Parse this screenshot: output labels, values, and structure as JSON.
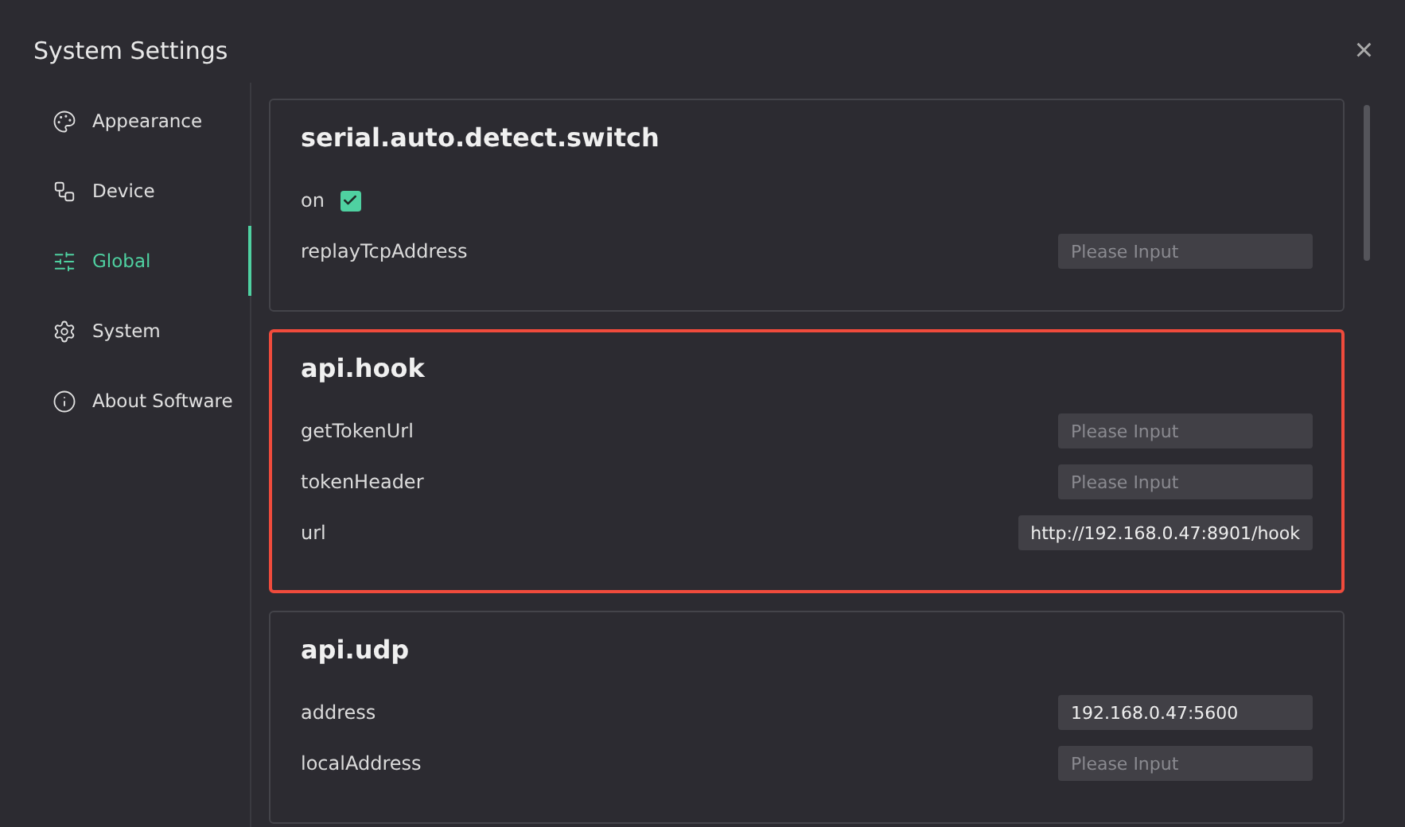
{
  "window": {
    "title": "System Settings",
    "close": "×"
  },
  "sidebar": {
    "items": [
      {
        "label": "Appearance",
        "selected": false
      },
      {
        "label": "Device",
        "selected": false
      },
      {
        "label": "Global",
        "selected": true
      },
      {
        "label": "System",
        "selected": false
      },
      {
        "label": "About Software",
        "selected": false
      }
    ]
  },
  "groups": [
    {
      "title": "serial.auto.detect.switch",
      "highlighted": false,
      "fields": [
        {
          "kind": "checkbox",
          "label": "on",
          "checked": true
        },
        {
          "kind": "input",
          "label": "replayTcpAddress",
          "placeholder": "Please Input"
        }
      ]
    },
    {
      "title": "api.hook",
      "highlighted": true,
      "fields": [
        {
          "kind": "input",
          "label": "getTokenUrl",
          "placeholder": "Please Input"
        },
        {
          "kind": "input",
          "label": "tokenHeader",
          "placeholder": "Please Input"
        },
        {
          "kind": "input",
          "label": "url",
          "value": "http://192.168.0.47:8901/hook"
        }
      ]
    },
    {
      "title": "api.udp",
      "highlighted": false,
      "fields": [
        {
          "kind": "input",
          "label": "address",
          "value": "192.168.0.47:5600"
        },
        {
          "kind": "input",
          "label": "localAddress",
          "placeholder": "Please Input"
        }
      ]
    }
  ]
}
